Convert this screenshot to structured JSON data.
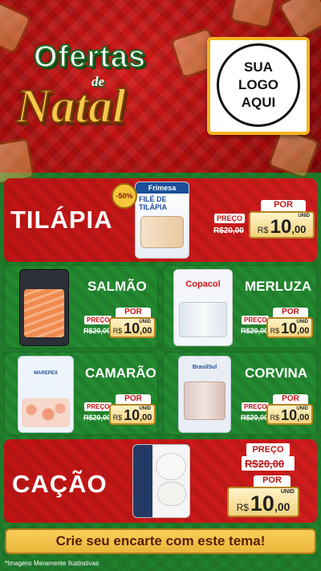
{
  "header": {
    "title_line1": "Ofertas",
    "title_de": "de",
    "title_line2": "Natal",
    "logo_lines": [
      "SUA",
      "LOGO",
      "AQUI"
    ]
  },
  "products": [
    {
      "name": "TILÁPIA",
      "pack_brand": "Frimesa",
      "pack_title": "FILÉ DE TILÁPIA",
      "badge": "-50%",
      "preco_label": "PREÇO",
      "old_price": "R$20,00",
      "por_label": "POR",
      "currency": "R$",
      "price_int": "10",
      "price_dec": ",00",
      "unit": "UNID"
    },
    {
      "name": "SALMÃO",
      "preco_label": "PREÇO",
      "old_price": "R$20,00",
      "por_label": "POR",
      "currency": "R$",
      "price_int": "10",
      "price_dec": ",00",
      "unit": "UNID"
    },
    {
      "name": "MERLUZA",
      "pack_brand": "Copacol",
      "preco_label": "PREÇO",
      "old_price": "R$20,00",
      "por_label": "POR",
      "currency": "R$",
      "price_int": "10",
      "price_dec": ",00",
      "unit": "UNID"
    },
    {
      "name": "CAMARÃO",
      "pack_brand": "MAREPEX",
      "preco_label": "PREÇO",
      "old_price": "R$20,00",
      "por_label": "POR",
      "currency": "R$",
      "price_int": "10",
      "price_dec": ",00",
      "unit": "UNID"
    },
    {
      "name": "CORVINA",
      "pack_brand": "BrasilSul",
      "preco_label": "PREÇO",
      "old_price": "R$20,00",
      "por_label": "POR",
      "currency": "R$",
      "price_int": "10",
      "price_dec": ",00",
      "unit": "UNID"
    },
    {
      "name": "CAÇÃO",
      "preco_label": "PREÇO",
      "old_price": "R$20,00",
      "por_label": "POR",
      "currency": "R$",
      "price_int": "10",
      "price_dec": ",00",
      "unit": "UNID"
    }
  ],
  "footer": {
    "cta": "Crie seu encarte com este tema!",
    "disclaimer": "*Imagens Meramente Ilustrativas"
  },
  "colors": {
    "red": "#c01414",
    "green": "#238a30",
    "gold": "#f2d27a",
    "footer_text": "#5b1d06"
  }
}
